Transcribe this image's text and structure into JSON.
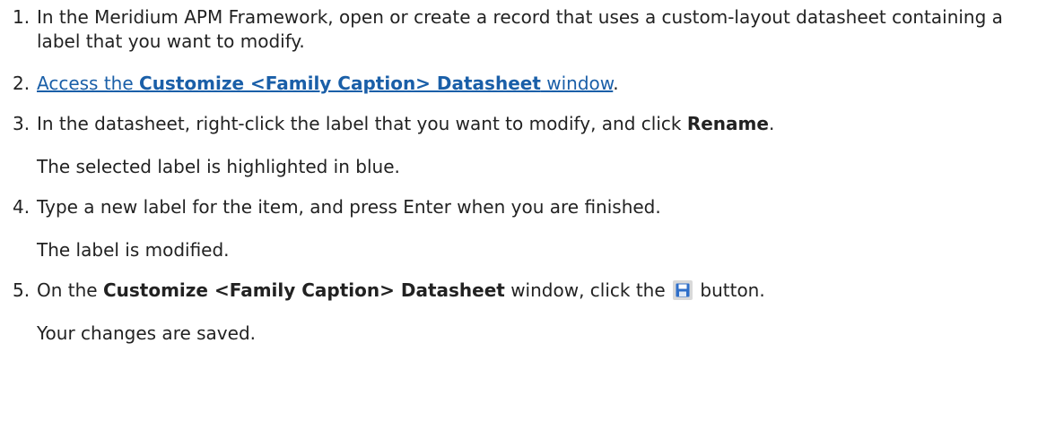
{
  "steps": [
    {
      "num": "1.",
      "text": "In the Meridium APM Framework, open or create a record that uses a custom-layout datasheet containing a label that you want to modify."
    },
    {
      "num": "2.",
      "link_prefix": "Access the ",
      "link_bold": "Customize <Family Caption> Datasheet",
      "link_suffix": " window",
      "after": "."
    },
    {
      "num": "3.",
      "before": "In the datasheet, right-click the label that you want to modify, and click ",
      "bold": "Rename",
      "after": ".",
      "result": "The selected label is highlighted in blue."
    },
    {
      "num": "4.",
      "text": "Type a new label for the item, and press Enter when you are finished.",
      "result": "The label is modified."
    },
    {
      "num": "5.",
      "before": "On the ",
      "bold": "Customize <Family Caption> Datasheet",
      "middle": " window, click the ",
      "icon": "save-icon",
      "after": " button.",
      "result": "Your changes are saved."
    }
  ],
  "colors": {
    "link": "#1a5fa8",
    "text": "#222222",
    "icon_bg": "#d9d9d9",
    "icon_blue": "#2f6fc9"
  }
}
